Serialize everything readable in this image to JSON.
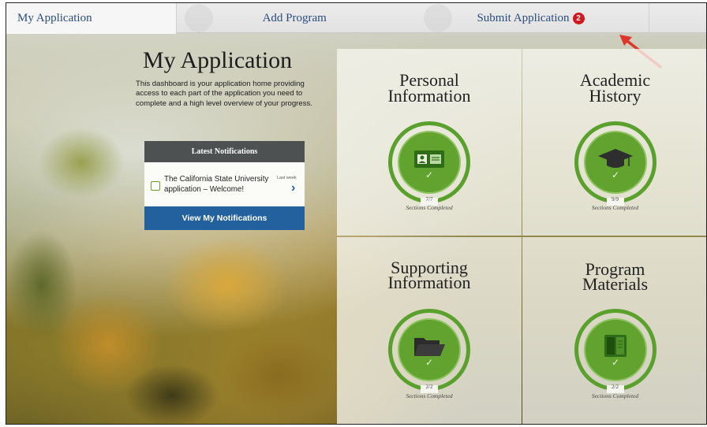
{
  "tabs": [
    {
      "label": "My Application"
    },
    {
      "label": "Add Program"
    },
    {
      "label": "Submit Application",
      "badge": "2"
    },
    {
      "label": ""
    }
  ],
  "intro": {
    "title": "My Application",
    "description": "This dashboard is your application home providing access to each part of the application you need to complete and a high level overview of your progress."
  },
  "notifications": {
    "header": "Latest Notifications",
    "item_message": "The California State University application – Welcome!",
    "item_time": "Last week",
    "button_label": "View My Notifications"
  },
  "panels": [
    {
      "title_line1": "Personal",
      "title_line2": "Information",
      "count": "7/7",
      "sub": "Sections Completed",
      "icon": "id-card-icon"
    },
    {
      "title_line1": "Academic",
      "title_line2": "History",
      "count": "9/9",
      "sub": "Sections Completed",
      "icon": "graduation-cap-icon"
    },
    {
      "title_line1": "Supporting",
      "title_line2": "Information",
      "count": "2/2",
      "sub": "Sections Completed",
      "icon": "folder-icon"
    },
    {
      "title_line1": "Program",
      "title_line2": "Materials",
      "count": "2/2",
      "sub": "Sections Completed",
      "icon": "book-icon"
    }
  ],
  "check_glyph": "✓",
  "chevron_glyph": "›",
  "colors": {
    "accent_green": "#5aa02c",
    "tab_text": "#2b4d7e",
    "button_blue": "#23609e",
    "badge_red": "#d0161e",
    "arrow_red": "#e0352b"
  }
}
